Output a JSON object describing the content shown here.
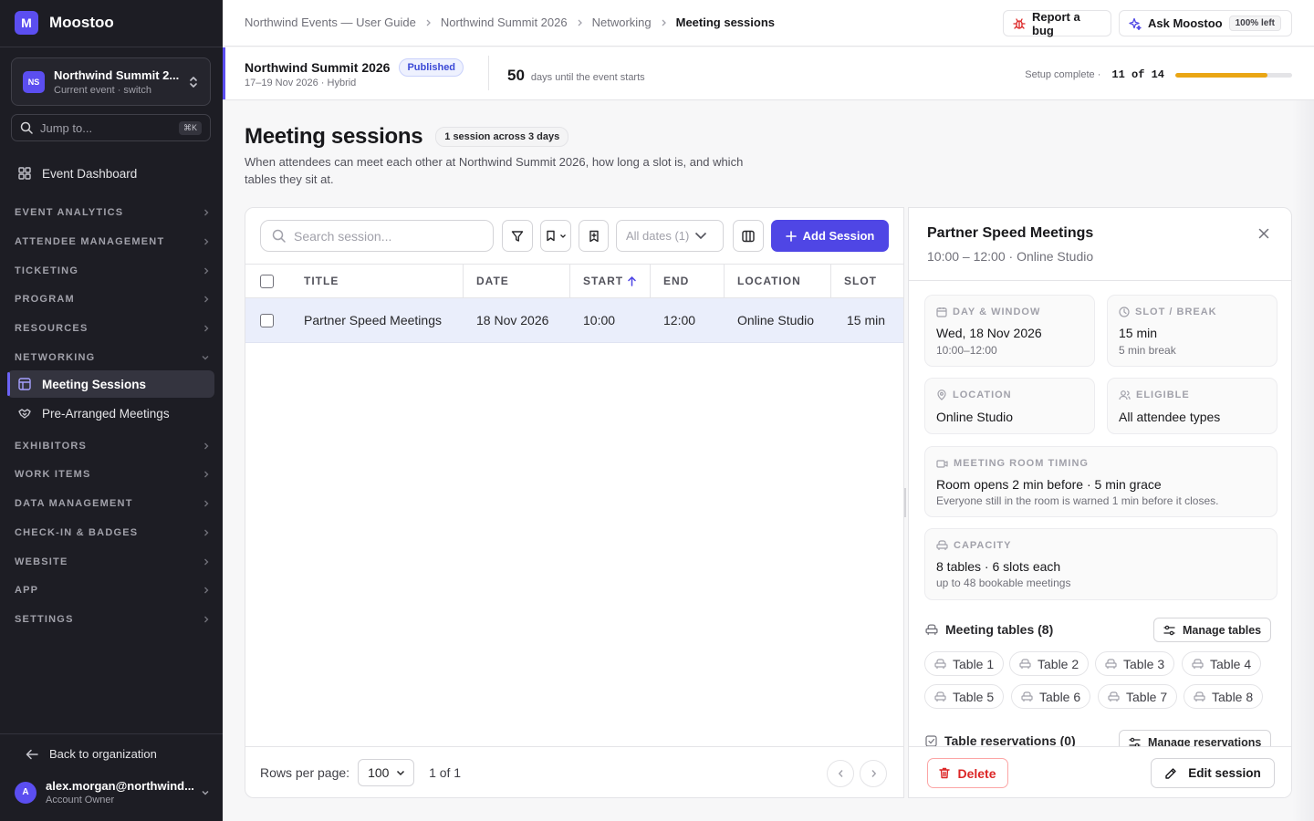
{
  "brand": {
    "logo": "M",
    "name": "Moostoo"
  },
  "event_switcher": {
    "badge": "NS",
    "name": "Northwind Summit 2...",
    "subtitle": "Current event · switch"
  },
  "jump": {
    "placeholder": "Jump to...",
    "shortcut": "⌘K"
  },
  "sidebar": {
    "dashboard": "Event Dashboard",
    "sections": [
      "EVENT ANALYTICS",
      "ATTENDEE MANAGEMENT",
      "TICKETING",
      "PROGRAM",
      "RESOURCES",
      "NETWORKING",
      "EXHIBITORS",
      "WORK ITEMS",
      "DATA MANAGEMENT",
      "CHECK-IN & BADGES",
      "WEBSITE",
      "APP",
      "SETTINGS"
    ],
    "networking_items": [
      "Meeting Sessions",
      "Pre-Arranged Meetings"
    ],
    "back": "Back to organization"
  },
  "user": {
    "avatar": "A",
    "email": "alex.morgan@northwind...",
    "role": "Account Owner"
  },
  "breadcrumb": [
    "Northwind Events — User Guide",
    "Northwind Summit 2026",
    "Networking",
    "Meeting sessions"
  ],
  "topbar": {
    "report_bug": "Report a bug",
    "ask": "Ask Moostoo",
    "ask_badge": "100% left"
  },
  "event": {
    "name": "Northwind Summit 2026",
    "status": "Published",
    "dates": "17–19 Nov 2026 · Hybrid",
    "days": "50",
    "days_text": "days until the event starts",
    "setup_label": "Setup complete ·",
    "setup_value": "11 of 14",
    "setup_done": 11,
    "setup_total": 14
  },
  "page": {
    "title": "Meeting sessions",
    "count": "1 session across 3 days",
    "description": "When attendees can meet each other at Northwind Summit 2026, how long a slot is, and which tables they sit at."
  },
  "toolbar": {
    "search_placeholder": "Search session...",
    "dates": "All dates (1)",
    "add": "Add Session"
  },
  "table": {
    "columns": [
      "TITLE",
      "DATE",
      "START",
      "END",
      "LOCATION",
      "SLOT"
    ],
    "rows": [
      {
        "title": "Partner Speed Meetings",
        "date": "18 Nov 2026",
        "start": "10:00",
        "end": "12:00",
        "location": "Online Studio",
        "slot": "15 min"
      }
    ]
  },
  "footer": {
    "rows_label": "Rows per page:",
    "rows_value": "100",
    "page": "1 of 1"
  },
  "detail": {
    "title": "Partner Speed Meetings",
    "subtitle": "10:00 – 12:00 · Online Studio",
    "day_label": "DAY & WINDOW",
    "day_value": "Wed, 18 Nov 2026",
    "day_sub": "10:00–12:00",
    "slot_label": "SLOT / BREAK",
    "slot_value": "15 min",
    "slot_sub": "5 min break",
    "location_label": "LOCATION",
    "location_value": "Online Studio",
    "eligible_label": "ELIGIBLE",
    "eligible_value": "All attendee types",
    "timing_label": "MEETING ROOM TIMING",
    "timing_value": "Room opens 2 min before · 5 min grace",
    "timing_sub": "Everyone still in the room is warned 1 min before it closes.",
    "capacity_label": "CAPACITY",
    "capacity_value": "8 tables · 6 slots each",
    "capacity_sub": "up to 48 bookable meetings",
    "tables_label": "Meeting tables (8)",
    "manage_tables": "Manage tables",
    "tables": [
      "Table 1",
      "Table 2",
      "Table 3",
      "Table 4",
      "Table 5",
      "Table 6",
      "Table 7",
      "Table 8"
    ],
    "reservations_label": "Table reservations (0)",
    "manage_reservations": "Manage reservations",
    "delete": "Delete",
    "edit": "Edit session"
  },
  "colors": {
    "accent": "#4f46e5",
    "sidebar_bg": "#1d1d24",
    "progress": "#eaa614",
    "danger": "#dc2626"
  }
}
